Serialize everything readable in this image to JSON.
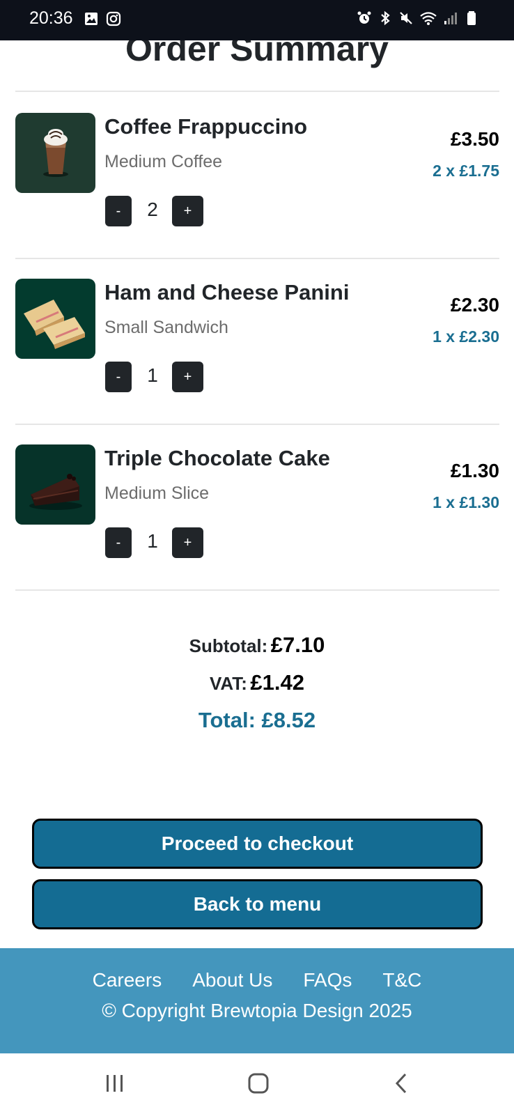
{
  "status_bar": {
    "time": "20:36",
    "left_icons": [
      "image-icon",
      "instagram-icon"
    ],
    "right_icons": [
      "alarm-icon",
      "bluetooth-icon",
      "mute-icon",
      "wifi-icon",
      "signal-icon",
      "battery-icon"
    ]
  },
  "page": {
    "title": "Order Summary"
  },
  "items": [
    {
      "name": "Coffee Frappuccino",
      "variant": "Medium Coffee",
      "quantity": "2",
      "price": "£3.50",
      "unit_line": "2 x £1.75",
      "minus": "-",
      "plus": "+",
      "image": "frappuccino-image"
    },
    {
      "name": "Ham and Cheese Panini",
      "variant": "Small Sandwich",
      "quantity": "1",
      "price": "£2.30",
      "unit_line": "1 x £2.30",
      "minus": "-",
      "plus": "+",
      "image": "panini-image"
    },
    {
      "name": "Triple Chocolate Cake",
      "variant": "Medium Slice",
      "quantity": "1",
      "price": "£1.30",
      "unit_line": "1 x £1.30",
      "minus": "-",
      "plus": "+",
      "image": "chocolate-cake-image"
    }
  ],
  "totals": {
    "subtotal_label": "Subtotal:",
    "subtotal_value": "£7.10",
    "vat_label": "VAT:",
    "vat_value": "£1.42",
    "total": "Total: £8.52"
  },
  "buttons": {
    "checkout": "Proceed to checkout",
    "back": "Back to menu"
  },
  "footer": {
    "links": [
      "Careers",
      "About Us",
      "FAQs",
      "T&C"
    ],
    "copyright": "© Copyright Brewtopia Design 2025"
  },
  "colors": {
    "accent": "#1a6e91",
    "button": "#146c93",
    "footer": "#4496bd",
    "dark": "#212529"
  },
  "android_nav": [
    "recents-icon",
    "home-icon",
    "back-icon"
  ]
}
